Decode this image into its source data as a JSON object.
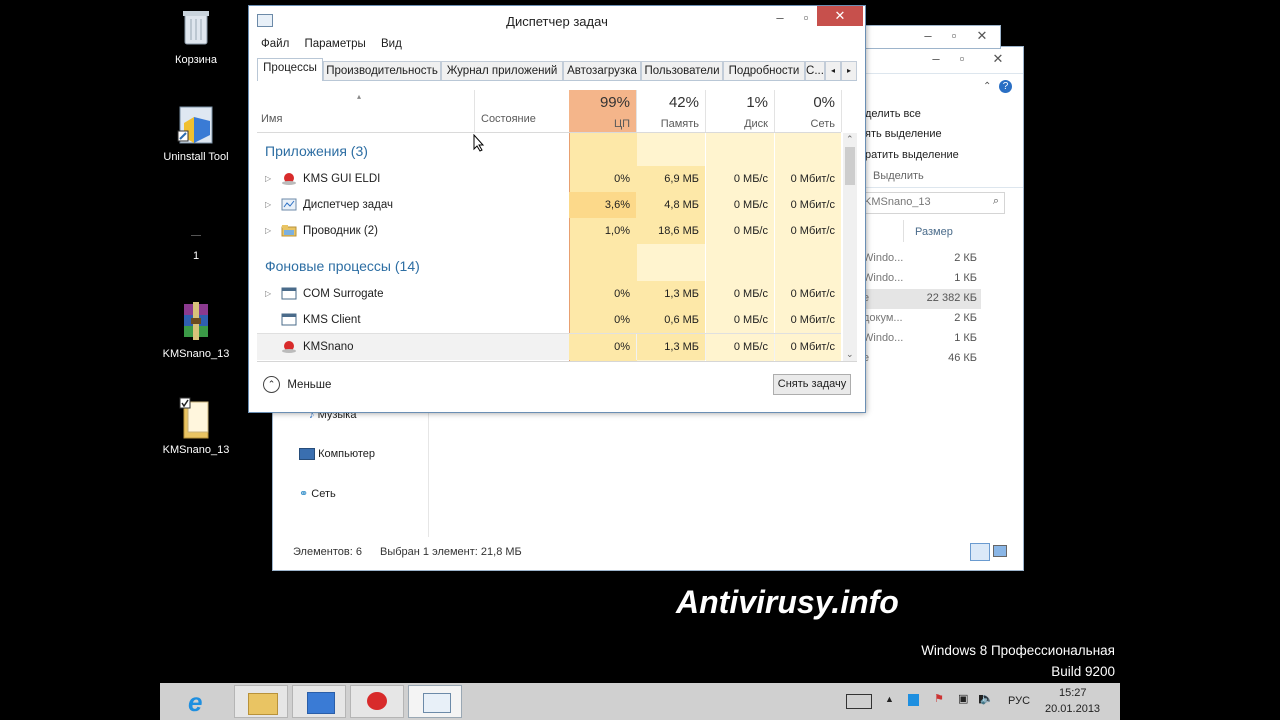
{
  "desktop": {
    "icons": [
      {
        "label": "Корзина"
      },
      {
        "label": "Uninstall Tool"
      },
      {
        "label": "1"
      },
      {
        "label": "KMSnano_13"
      },
      {
        "label": "KMSnano_13"
      }
    ],
    "watermark": "Antivirusy.info",
    "os_edition": "Windows 8 Профессиональная",
    "os_build": "Build 9200"
  },
  "task_manager": {
    "title": "Диспетчер задач",
    "menu": [
      "Файл",
      "Параметры",
      "Вид"
    ],
    "tabs": [
      "Процессы",
      "Производительность",
      "Журнал приложений",
      "Автозагрузка",
      "Пользователи",
      "Подробности",
      "С..."
    ],
    "columns": {
      "name": "Имя",
      "status": "Состояние",
      "cpu_pct": "99%",
      "cpu": "ЦП",
      "mem_pct": "42%",
      "mem": "Память",
      "disk_pct": "1%",
      "disk": "Диск",
      "net_pct": "0%",
      "net": "Сеть"
    },
    "groups": {
      "apps": "Приложения (3)",
      "background": "Фоновые процессы (14)"
    },
    "apps": [
      {
        "name": "KMS GUI ELDI",
        "cpu": "0%",
        "mem": "6,9 МБ",
        "disk": "0 МБ/с",
        "net": "0 Мбит/с"
      },
      {
        "name": "Диспетчер задач",
        "cpu": "3,6%",
        "mem": "4,8 МБ",
        "disk": "0 МБ/с",
        "net": "0 Мбит/с"
      },
      {
        "name": "Проводник (2)",
        "cpu": "1,0%",
        "mem": "18,6 МБ",
        "disk": "0 МБ/с",
        "net": "0 Мбит/с"
      }
    ],
    "background": [
      {
        "name": "COM Surrogate",
        "cpu": "0%",
        "mem": "1,3 МБ",
        "disk": "0 МБ/с",
        "net": "0 Мбит/с"
      },
      {
        "name": "KMS Client",
        "cpu": "0%",
        "mem": "0,6 МБ",
        "disk": "0 МБ/с",
        "net": "0 Мбит/с"
      },
      {
        "name": "KMSnano",
        "cpu": "0%",
        "mem": "1,3 МБ",
        "disk": "0 МБ/с",
        "net": "0 Мбит/с"
      }
    ],
    "fewer_label": "Меньше",
    "end_task_label": "Снять задачу"
  },
  "explorer": {
    "ribbon": [
      "делить все",
      "ять выделение",
      "ратить выделение"
    ],
    "ribbon_group": "Выделить",
    "search_placeholder": "KMSnano_13",
    "size_header": "Размер",
    "files": [
      {
        "type": "Windo...",
        "size": "2 КБ"
      },
      {
        "type": "Windo...",
        "size": "1 КБ"
      },
      {
        "type": "е",
        "size": "22 382 КБ"
      },
      {
        "type": "докум...",
        "size": "2 КБ"
      },
      {
        "type": "Windo...",
        "size": "1 КБ"
      },
      {
        "type": "е",
        "size": "46 КБ"
      }
    ],
    "nav": [
      "Музыка",
      "Компьютер",
      "Сеть"
    ],
    "status_items": "Элементов: 6",
    "status_selected": "Выбран 1 элемент: 21,8 МБ"
  },
  "taskbar": {
    "lang": "РУС",
    "time": "15:27",
    "date": "20.01.2013"
  },
  "colors": {
    "cpu_header": "#f4b58a",
    "heat_light": "#fff4cf",
    "heat_mid": "#fde8a8",
    "group_text": "#2d6ea3"
  }
}
